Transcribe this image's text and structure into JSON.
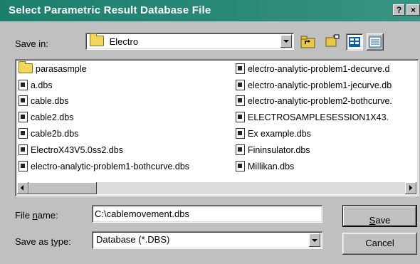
{
  "window": {
    "title": "Select Parametric Result Database File",
    "help_glyph": "?",
    "close_glyph": "×"
  },
  "save_in": {
    "label": "Save in:",
    "value": "Electro"
  },
  "toolbar": {
    "icons": [
      "up-one-level-icon",
      "desktop-icon",
      "new-folder-icon",
      "list-view-icon",
      "details-view-icon"
    ]
  },
  "files": {
    "column1": [
      {
        "name": "parasasmple",
        "type": "folder"
      },
      {
        "name": "a.dbs",
        "type": "file"
      },
      {
        "name": "cable.dbs",
        "type": "file"
      },
      {
        "name": "cable2.dbs",
        "type": "file"
      },
      {
        "name": "cable2b.dbs",
        "type": "file"
      },
      {
        "name": "ElectroX43V5.0ss2.dbs",
        "type": "file"
      },
      {
        "name": "electro-analytic-problem1-bothcurve.dbs",
        "type": "file"
      }
    ],
    "column2": [
      {
        "name": "electro-analytic-problem1-decurve.d",
        "type": "file"
      },
      {
        "name": "electro-analytic-problem1-jecurve.db",
        "type": "file"
      },
      {
        "name": "electro-analytic-problem2-bothcurve.",
        "type": "file"
      },
      {
        "name": "ELECTROSAMPLESESSION1X43.",
        "type": "file"
      },
      {
        "name": "Ex example.dbs",
        "type": "file"
      },
      {
        "name": "Fininsulator.dbs",
        "type": "file"
      },
      {
        "name": "Millikan.dbs",
        "type": "file"
      }
    ]
  },
  "file_name": {
    "label_pre": "File ",
    "label_u": "n",
    "label_post": "ame:",
    "value": "C:\\cablemovement.dbs"
  },
  "save_as_type": {
    "label_pre": "Save as ",
    "label_u": "t",
    "label_post": "ype:",
    "value": "Database (*.DBS)"
  },
  "buttons": {
    "save_u": "S",
    "save_rest": "ave",
    "cancel": "Cancel"
  }
}
